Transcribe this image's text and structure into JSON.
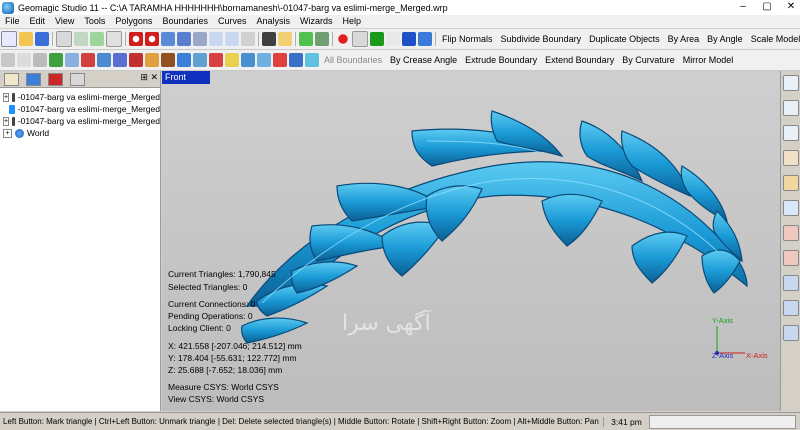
{
  "window": {
    "title": "Geomagic Studio 11 -- C:\\A TARAMHA HHHHHHH\\bornamanesh\\-01047-barg va eslimi-merge_Merged.wrp",
    "controls": [
      "–",
      "▢",
      "✕"
    ]
  },
  "menu": [
    "File",
    "Edit",
    "View",
    "Tools",
    "Polygons",
    "Boundaries",
    "Curves",
    "Analysis",
    "Wizards",
    "Help"
  ],
  "toolbar1": {
    "buttons": [
      "Flip Normals",
      "Subdivide Boundary",
      "Duplicate Objects",
      "By Area",
      "By Angle",
      "Scale Model"
    ]
  },
  "toolbar2": {
    "disabled_label": "All Boundaries",
    "buttons": [
      "By Crease Angle",
      "Extrude Boundary",
      "Extend Boundary",
      "By Curvature",
      "Mirror Model"
    ]
  },
  "left_panel": {
    "tree": [
      {
        "label": "-01047-barg va eslimi-merge_Merged",
        "icon_color": "#444444"
      },
      {
        "label": "-01047-barg va eslimi-merge_Merged",
        "icon_color": "#1e90ff"
      },
      {
        "label": "-01047-barg va eslimi-merge_Merged",
        "icon_color": "#444444"
      },
      {
        "label": "World",
        "icon_color": "#2a6fd0"
      }
    ],
    "controls": "⊞ ✕"
  },
  "viewport": {
    "label": "Front",
    "stats": {
      "current_triangles": "Current Triangles: 1,790,845",
      "selected_triangles": "Selected Triangles: 0",
      "current_connections": "Current Connections: 0",
      "pending_operations": "Pending Operations: 0",
      "locking_client": "Locking Client: 0",
      "x": "X: 421.558 [-207.046; 214.512] mm",
      "y": "Y: 178.404 [-55.631; 122.772] mm",
      "z": "Z: 25.688 [-7.652; 18.036] mm",
      "measure_csys": "Measure CSYS: World CSYS",
      "view_csys": "View CSYS: World CSYS"
    },
    "axes": {
      "y": "Y-Axis",
      "z": "Z-Axis",
      "x": "X-Axis"
    },
    "watermark": "آگهی سرا",
    "model_color": "#1a9ad6"
  },
  "status": {
    "message": "Left Button: Mark triangle | Ctrl+Left Button: Unmark triangle | Del: Delete selected triangle(s) | Middle Button: Rotate | Shift+Right Button: Zoom | Alt+Middle Button: Pan",
    "time": "3:41 pm"
  }
}
